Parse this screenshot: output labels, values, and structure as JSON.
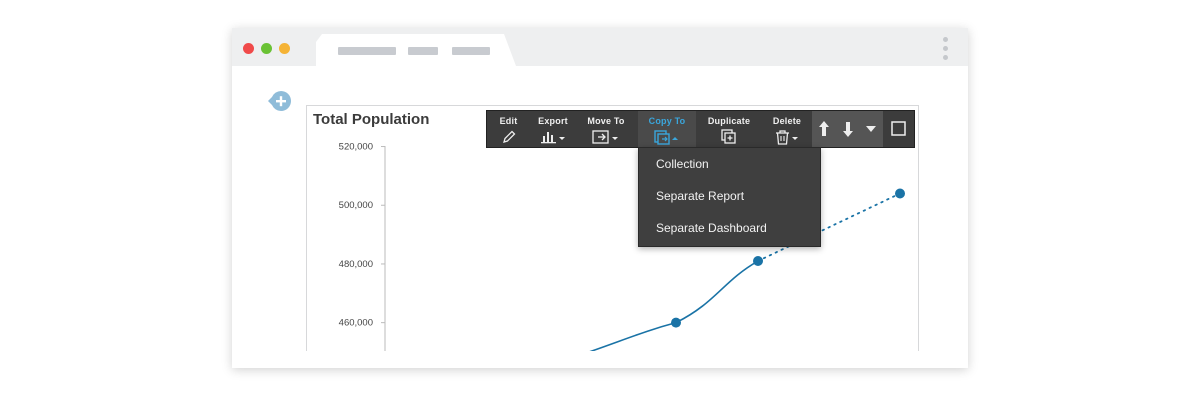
{
  "window": {
    "traffic_lights": [
      "close",
      "minimize",
      "zoom"
    ]
  },
  "chart": {
    "title": "Total Population",
    "y_ticks": [
      "520,000",
      "500,000",
      "480,000",
      "460,000"
    ]
  },
  "toolbar": {
    "edit_label": "Edit",
    "export_label": "Export",
    "move_to_label": "Move To",
    "copy_to_label": "Copy To",
    "duplicate_label": "Duplicate",
    "delete_label": "Delete"
  },
  "copy_menu": {
    "items": [
      "Collection",
      "Separate Report",
      "Separate Dashboard"
    ]
  },
  "colors": {
    "accent": "#3aa6dc",
    "series": "#1a73a6",
    "toolbar_bg": "#3c3c3c"
  },
  "chart_data": {
    "type": "line",
    "y_ticks": [
      520000,
      500000,
      480000,
      460000
    ],
    "ylim": [
      450000,
      527000
    ],
    "points": [
      {
        "y": 450000
      },
      {
        "y": 460000
      },
      {
        "y": 481000
      },
      {
        "y": 504000
      }
    ],
    "grid": false
  }
}
